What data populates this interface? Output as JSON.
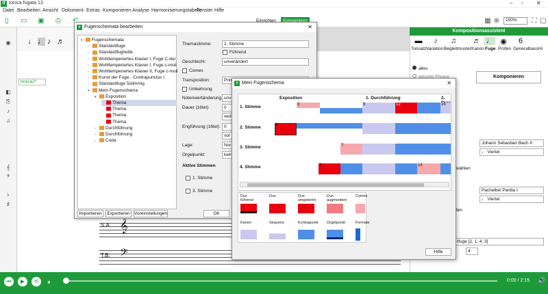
{
  "app": {
    "title": "tonica fugata 13",
    "logo": "tf"
  },
  "menu": [
    "Datei",
    "Bearbeiten",
    "Ansicht",
    "Dokument",
    "Extras",
    "Komponieren",
    "Analyse",
    "Harmonisierungstabelle",
    "Fenster",
    "Hilfe"
  ],
  "toolbar": {
    "einrichten": "Einrichten",
    "komponieren": "Komponieren",
    "zoom": "100%"
  },
  "score": {
    "tab": "tonica2*",
    "staff1": "S.A.",
    "staff2": "T.B."
  },
  "assistant": {
    "header": "Kompositionsassistent",
    "tabs": [
      "Tonsatz",
      "Variation",
      "Begleitmuster",
      "Kanon",
      "Fuge",
      "Prüfen",
      "Generalbass",
      "Hi"
    ],
    "radio_alles": "alles",
    "radio_phrase": "aktuelle Phrase",
    "compose_button": "Komponieren",
    "field1": "Johann Sebastian Bach II",
    "field2": "Viertel",
    "waehlen": "wählen",
    "field3": "Pachelbel Partita I",
    "field4": "Viertel",
    "ten": "ten",
    "field5": "rfuge [2, 1, 4, 3]",
    "stepper_value": "4"
  },
  "dialog1": {
    "title": "Fugenschemata bearbeiten",
    "tree": [
      {
        "label": "Fugenschemata",
        "level": 0
      },
      {
        "label": "Standardfuge",
        "level": 1
      },
      {
        "label": "Standardfughette",
        "level": 1
      },
      {
        "label": "Wohltemperiertes Klavier I, Fuge C-dur",
        "level": 1
      },
      {
        "label": "Wohltemperiertes Klavier I, Fuge c-moll",
        "level": 1
      },
      {
        "label": "Wohltemperiertes Klavier II, Fuge c-moll",
        "level": 1
      },
      {
        "label": "Kunst der Fuge - Contrapunctus I",
        "level": 1
      },
      {
        "label": "Standardfuge 5stimmig",
        "level": 1
      },
      {
        "label": "Mein Fugenschema",
        "level": 1
      },
      {
        "label": "Exposition",
        "level": 2
      },
      {
        "label": "Thema",
        "level": 3
      },
      {
        "label": "Thema",
        "level": 3
      },
      {
        "label": "Thema",
        "level": 3
      },
      {
        "label": "Thema",
        "level": 3
      },
      {
        "label": "Durchführung",
        "level": 2
      },
      {
        "label": "Durchführung",
        "level": 2
      },
      {
        "label": "Coda",
        "level": 2
      }
    ],
    "labels": {
      "themastimme": "Themastimme:",
      "geschlecht": "Geschlecht:",
      "transposition": "Transposition:",
      "notenwert": "Notenwertänderung:",
      "dauer": "Dauer (16tel):",
      "engfuehrung": "Engführung (16tel):",
      "lage": "Lage:",
      "orgelpunkt": "Orgelpunkt:",
      "aktive": "Aktive Stimmen"
    },
    "values": {
      "themastimme": "2. Stimme",
      "fuehrend": "Führend",
      "geschlecht": "unverändert",
      "comes": "Comes",
      "transposition": "Prim",
      "umkehrung": "Umkehrung",
      "notenwert": "unv",
      "dauer": "0",
      "verb": "verb",
      "engf": "0",
      "vor": "vor",
      "lage": "Nor",
      "orgel": "kein",
      "stimme1": "1. Stimme",
      "stimme3": "3. Stimme"
    },
    "buttons": {
      "importieren": "Importieren",
      "exportieren": "Exportieren",
      "voreinstellungen": "Voreinstellungen",
      "ok": "OK"
    }
  },
  "dialog2": {
    "title": "Mein Fugenschema",
    "sections": [
      "Exposition",
      "1. Durchführung",
      "2. Durc"
    ],
    "rows": [
      "1. Stimme",
      "2. Stimme",
      "3. Stimme",
      "4. Stimme"
    ],
    "numbers": [
      "3",
      "9",
      "12",
      "16",
      "1",
      "7",
      "3",
      "14"
    ],
    "legend": [
      {
        "label": "Dux\nführend"
      },
      {
        "label": "Dux"
      },
      {
        "label": "Dux\numgekehrt"
      },
      {
        "label": "Dux\naugmentiert"
      },
      {
        "label": "Comes"
      },
      {
        "label": "Kanon"
      },
      {
        "label": "Sequenz"
      },
      {
        "label": "Kontrapunkt"
      },
      {
        "label": "Orgelpunkt"
      },
      {
        "label": "Fermate"
      }
    ],
    "help": "Hilfe"
  },
  "player": {
    "time": "0:00 / 2:15"
  },
  "colors": {
    "green": "#1f9a3b",
    "red": "#e8000f",
    "lightred": "#f4a0a6",
    "blue": "#4f8fe8",
    "lightblue": "#c8c8f0"
  }
}
